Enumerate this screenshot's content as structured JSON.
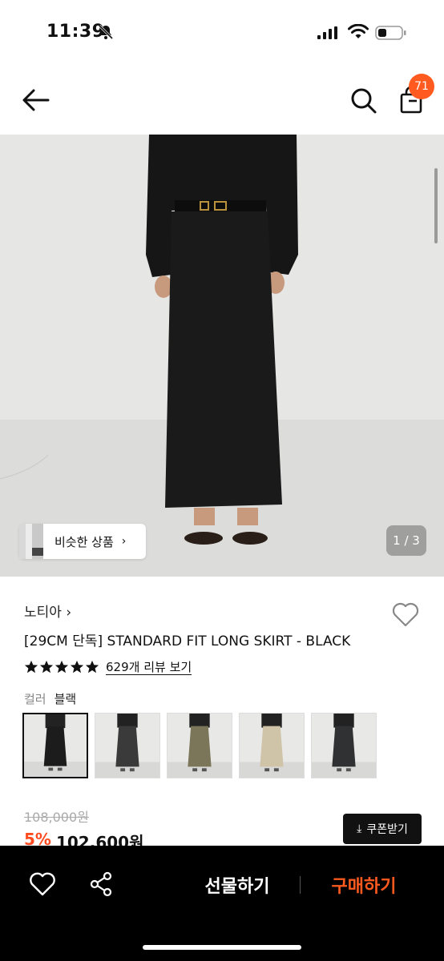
{
  "status": {
    "time": "11:39"
  },
  "header": {
    "cart_count": "71"
  },
  "gallery": {
    "similar_label": "비슷한 상품",
    "page": "1 / 3"
  },
  "product": {
    "brand": "노티아 ›",
    "title": "[29CM 단독] STANDARD FIT LONG SKIRT - BLACK",
    "rating_stars": 5,
    "review_link": "629개 리뷰 보기",
    "option_label": "컬러",
    "option_value": "블랙",
    "color_thumbnails": [
      {
        "name": "black",
        "color": "#1c1c1c"
      },
      {
        "name": "charcoal",
        "color": "#3a3a3a"
      },
      {
        "name": "khaki",
        "color": "#7b7659"
      },
      {
        "name": "beige",
        "color": "#cfc3a8"
      },
      {
        "name": "dark-grey",
        "color": "#2f3133"
      }
    ],
    "original_price": "108,000원",
    "discount": "5%",
    "price": "102,600원",
    "coupon_label": "쿠폰받기"
  },
  "bottom_bar": {
    "gift_label": "선물하기",
    "buy_label": "구매하기"
  },
  "colors": {
    "accent": "#ff5a1f",
    "bottom_bar": "#000000"
  }
}
